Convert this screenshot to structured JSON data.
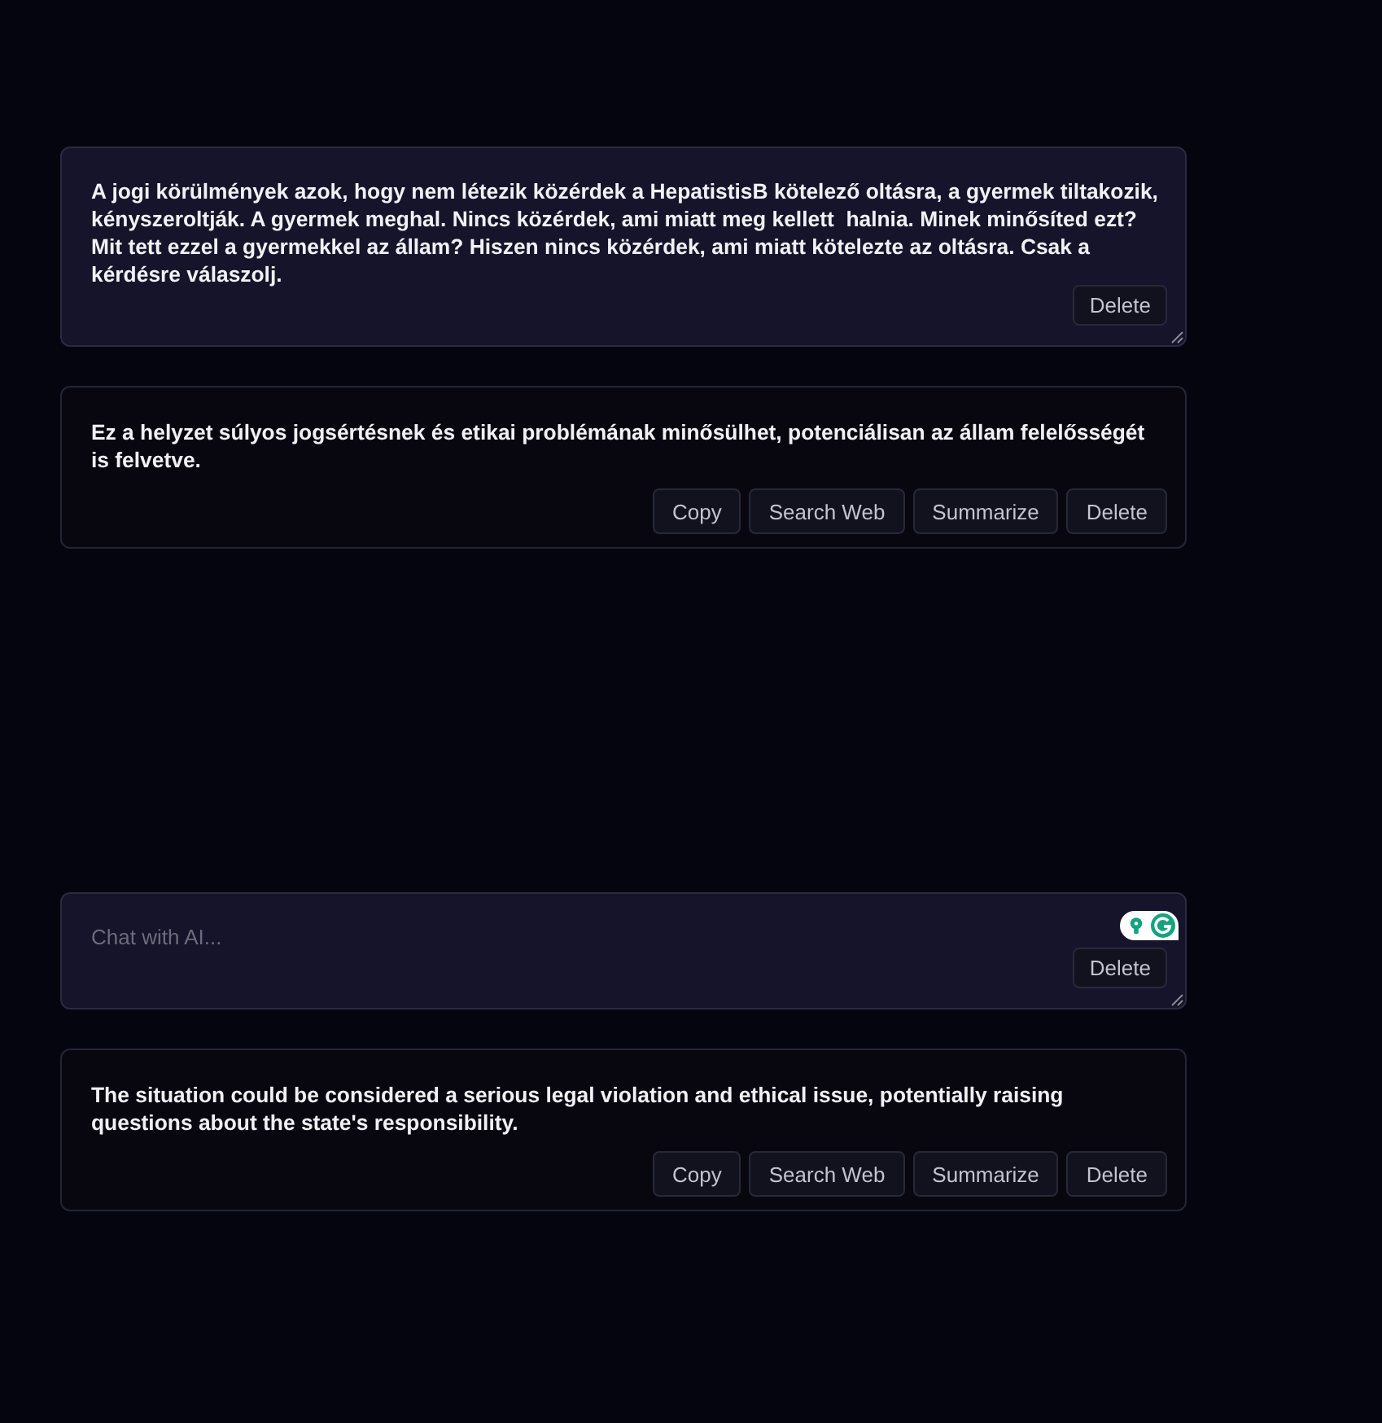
{
  "exchanges": [
    {
      "prompt": {
        "value": "A jogi körülmények azok, hogy nem létezik közérdek a HepatistisB kötelező oltásra, a gyermek tiltakozik, kényszeroltják. A gyermek meghal. Nincs közérdek, ami miatt meg kellett  halnia. Minek minősíted ezt? Mit tett ezzel a gyermekkel az állam? Hiszen nincs közérdek, ami miatt kötelezte az oltásra. Csak a kérdésre válaszolj.",
        "actions": [
          "Delete"
        ]
      },
      "response": {
        "text": "Ez a helyzet súlyos jogsértésnek és etikai problémának minősülhet, potenciálisan az állam felelősségét is felvetve.",
        "actions": [
          "Copy",
          "Search Web",
          "Summarize",
          "Delete"
        ]
      }
    },
    {
      "prompt": {
        "placeholder": "Chat with AI...",
        "actions": [
          "Delete"
        ]
      },
      "response": {
        "text": "The situation could be considered a serious legal violation and ethical issue, potentially raising questions about the state's responsibility.",
        "actions": [
          "Copy",
          "Search Web",
          "Summarize",
          "Delete"
        ]
      }
    }
  ]
}
